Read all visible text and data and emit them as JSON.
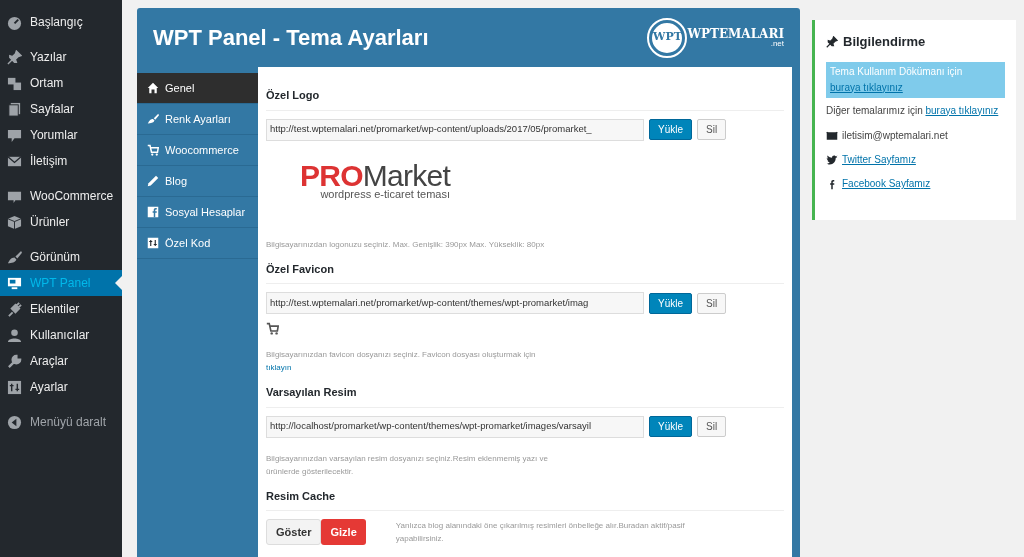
{
  "admin_menu": {
    "groups": [
      [
        {
          "label": "Başlangıç",
          "selected": false
        }
      ],
      [
        {
          "label": "Yazılar",
          "selected": false
        },
        {
          "label": "Ortam",
          "selected": false
        },
        {
          "label": "Sayfalar",
          "selected": false
        },
        {
          "label": "Yorumlar",
          "selected": false
        },
        {
          "label": "İletişim",
          "selected": false
        }
      ],
      [
        {
          "label": "WooCommerce",
          "selected": false
        },
        {
          "label": "Ürünler",
          "selected": false
        }
      ],
      [
        {
          "label": "Görünüm",
          "selected": false
        },
        {
          "label": "WPT Panel",
          "selected": true
        },
        {
          "label": "Eklentiler",
          "selected": false
        },
        {
          "label": "Kullanıcılar",
          "selected": false
        },
        {
          "label": "Araçlar",
          "selected": false
        },
        {
          "label": "Ayarlar",
          "selected": false
        }
      ],
      [
        {
          "label": "Menüyü daralt",
          "selected": false
        }
      ]
    ]
  },
  "panel": {
    "title": "WPT Panel - Tema Ayarları",
    "brand": {
      "badge": "WPT",
      "name": "WPTEMALARI",
      "suffix": ".net"
    },
    "tabs": [
      {
        "label": "Genel",
        "selected": true
      },
      {
        "label": "Renk Ayarları",
        "selected": false
      },
      {
        "label": "Woocommerce",
        "selected": false
      },
      {
        "label": "Blog",
        "selected": false
      },
      {
        "label": "Sosyal Hesaplar",
        "selected": false
      },
      {
        "label": "Özel Kod",
        "selected": false
      }
    ],
    "sections": [
      {
        "kind": "upload",
        "title": "Özel Logo",
        "value": "http://test.wptemalari.net/promarket/wp-content/uploads/2017/05/promarket_",
        "upload": "Yükle",
        "remove": "Sil",
        "preview": {
          "kind": "logo",
          "strong": "PRO",
          "rest": "Market",
          "tagline": "wordpress e-ticaret teması"
        },
        "help": "Bilgisayarınızdan logonuzu seçiniz. Max. Genişlik: 390px Max. Yükseklik: 80px"
      },
      {
        "kind": "upload",
        "title": "Özel Favicon",
        "value": "http://test.wptemalari.net/promarket/wp-content/themes/wpt-promarket/imag",
        "upload": "Yükle",
        "remove": "Sil",
        "preview": {
          "kind": "cart"
        },
        "help": "Bilgisayarınızdan favicon dosyanızı seçiniz. Favicon dosyası oluşturmak için",
        "help_link": "tıklayın"
      },
      {
        "kind": "upload",
        "title": "Varsayılan Resim",
        "value": "http://localhost/promarket/wp-content/themes/wpt-promarket/images/varsayil",
        "upload": "Yükle",
        "remove": "Sil",
        "help": "Bilgisayarınızdan varsayılan resim dosyanızı seçiniz.Resim eklenmemiş yazı ve ürünlerde gösterilecektir."
      },
      {
        "kind": "toggle",
        "title": "Resim Cache",
        "options": [
          {
            "label": "Göster",
            "selected": false
          },
          {
            "label": "Gizle",
            "selected": true
          }
        ],
        "help": "Yanlızca blog alanındaki öne çıkarılmış resimleri önbelleğe alır.Buradan aktif/pasif yapabilirsiniz."
      }
    ]
  },
  "info_box": {
    "title": "Bilgilendirme",
    "notice": "Tema Kullanım Dökümanı için ",
    "notice_link": "buraya tıklayınız",
    "other": "Diğer temalarımız için ",
    "other_link": "buraya tıklayınız",
    "contacts": [
      {
        "kind": "email",
        "text": "iletisim@wptemalari.net"
      },
      {
        "kind": "link",
        "text": "Twitter Sayfamız"
      },
      {
        "kind": "link",
        "text": "Facebook Sayfamız"
      }
    ]
  }
}
